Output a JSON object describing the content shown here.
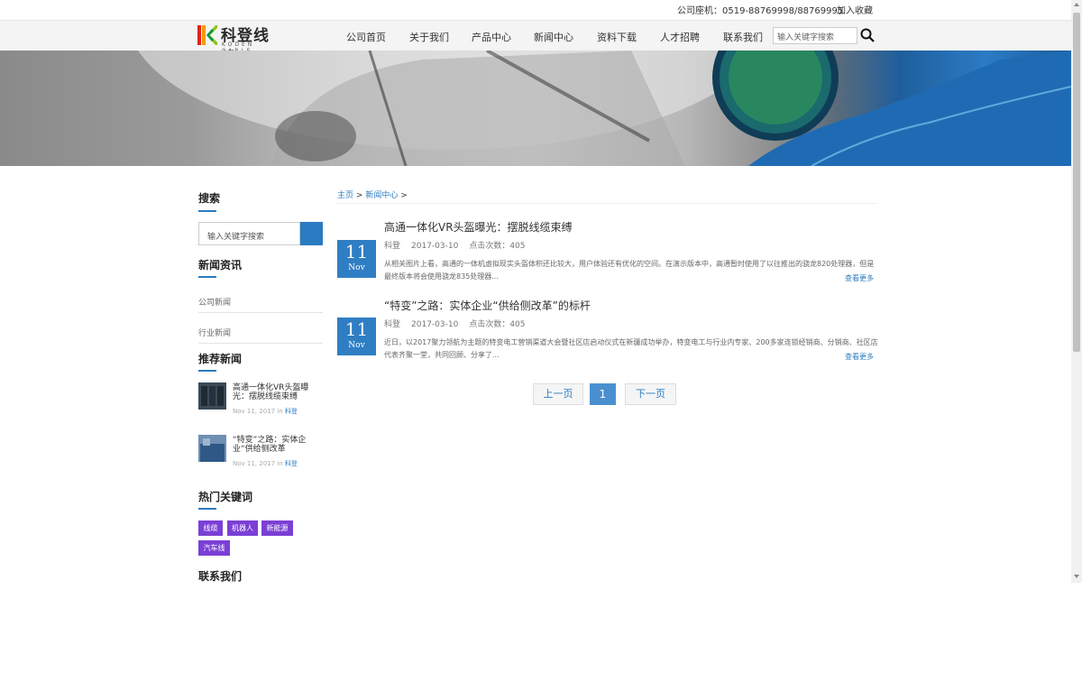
{
  "topbar": {
    "phone": "公司座机：0519-88769998/88769995",
    "favorite": "加入收藏"
  },
  "logo": {
    "cn": "科登线缆",
    "en": "KODEN CABLE"
  },
  "nav": {
    "items": [
      "公司首页",
      "关于我们",
      "产品中心",
      "新闻中心",
      "资料下载",
      "人才招聘",
      "联系我们"
    ],
    "search_placeholder": "输入关键字搜索"
  },
  "sidebar": {
    "search_title": "搜索",
    "search_placeholder": "输入关键字搜索",
    "news_title": "新闻资讯",
    "news_links": [
      "公司新闻",
      "行业新闻"
    ],
    "recommend_title": "推荐新闻",
    "recommended": [
      {
        "title": "高通一体化VR头盔曝光：摆脱线缆束缚",
        "date": "Nov 11, 2017",
        "in": "in",
        "source": "科登"
      },
      {
        "title": "“特变”之路：实体企业“供给侧改革",
        "date": "Nov 11, 2017",
        "in": "in",
        "source": "科登"
      }
    ],
    "keywords_title": "热门关键词",
    "keywords": [
      "线缆",
      "机器人",
      "新能源",
      "汽车线"
    ],
    "contact_title": "联系我们"
  },
  "breadcrumb": {
    "home": "主页",
    "sep": ">",
    "current": "新闻中心",
    "tail": ">"
  },
  "articles": [
    {
      "title": "高通一体化VR头盔曝光：摆脱线缆束缚",
      "author": "科登",
      "date": "2017-03-10",
      "views": "点击次数：405",
      "day": "11",
      "month": "Nov",
      "summary": "从相关图片上看，高通的一体机虚拟现实头盔体积还比较大，用户体验还有优化的空间。在演示版本中，高通暂时使用了以往推出的骁龙820处理器，但是最终版本将会使用骁龙835处理器...",
      "more": "查看更多"
    },
    {
      "title": "“特变”之路：实体企业“供给侧改革”的标杆",
      "author": "科登",
      "date": "2017-03-10",
      "views": "点击次数：405",
      "day": "11",
      "month": "Nov",
      "summary": "近日，以2017聚力领航为主题的特变电工营销渠道大会暨社区店启动仪式在新疆成功举办，特变电工与行业内专家、200多家连锁经销商、分销商、社区店代表齐聚一堂，共同回顾、分享了...",
      "more": "查看更多"
    }
  ],
  "pager": {
    "prev": "上一页",
    "current": "1",
    "next": "下一页"
  },
  "colors": {
    "accent": "#2a7bc1",
    "tag": "#7b3fd6"
  }
}
